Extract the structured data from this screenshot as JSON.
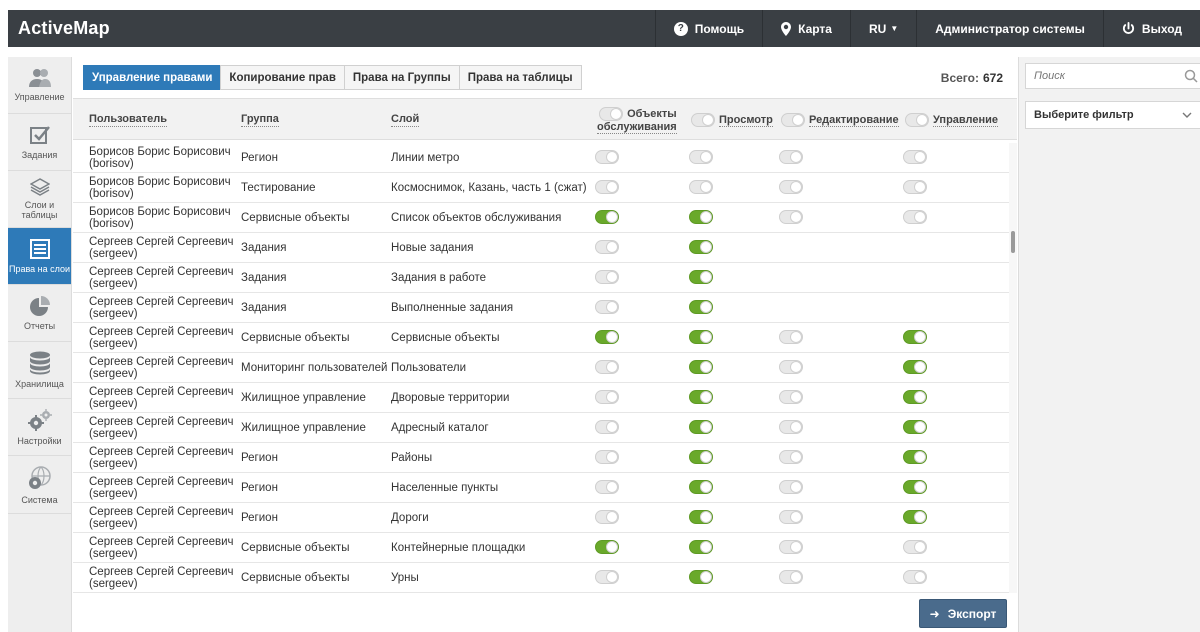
{
  "app": {
    "title": "ActiveMap"
  },
  "topbar": {
    "help": "Помощь",
    "map": "Карта",
    "lang": "RU",
    "user": "Администратор системы",
    "logout": "Выход"
  },
  "sidebar": {
    "items": [
      {
        "label": "Управление",
        "icon": "users-icon",
        "active": false
      },
      {
        "label": "Задания",
        "icon": "checkbox-icon",
        "active": false
      },
      {
        "label": "Слои и таблицы",
        "icon": "layers-icon",
        "active": false
      },
      {
        "label": "Права на слои",
        "icon": "list-icon",
        "active": true
      },
      {
        "label": "Отчеты",
        "icon": "pie-chart-icon",
        "active": false
      },
      {
        "label": "Хранилища",
        "icon": "database-icon",
        "active": false
      },
      {
        "label": "Настройки",
        "icon": "gears-icon",
        "active": false
      },
      {
        "label": "Система",
        "icon": "globe-gear-icon",
        "active": false
      }
    ]
  },
  "tabs": [
    {
      "label": "Управление правами",
      "active": true
    },
    {
      "label": "Копирование прав",
      "active": false
    },
    {
      "label": "Права на Группы",
      "active": false
    },
    {
      "label": "Права на таблицы",
      "active": false
    }
  ],
  "total": {
    "label": "Всего:",
    "value": "672"
  },
  "table": {
    "columns": {
      "user": "Пользователь",
      "group": "Группа",
      "layer": "Слой",
      "service_1": "Объекты",
      "service_2": "обслуживания",
      "view": "Просмотр",
      "edit": "Редактирование",
      "manage": "Управление"
    },
    "rows": [
      {
        "user1": "Борисов Борис Борисович",
        "user2": "(borisov)",
        "group": "Регион",
        "layer": "Линии метро",
        "t": [
          0,
          0,
          0,
          0
        ]
      },
      {
        "user1": "Борисов Борис Борисович",
        "user2": "(borisov)",
        "group": "Тестирование",
        "layer": "Космоснимок, Казань, часть 1 (сжат)",
        "t": [
          0,
          0,
          0,
          0
        ]
      },
      {
        "user1": "Борисов Борис Борисович",
        "user2": "(borisov)",
        "group": "Сервисные объекты",
        "layer": "Список объектов обслуживания",
        "t": [
          1,
          1,
          0,
          0
        ]
      },
      {
        "user1": "Сергеев Сергей Сергеевич",
        "user2": "(sergeev)",
        "group": "Задания",
        "layer": "Новые задания",
        "t": [
          0,
          1,
          -1,
          -1
        ]
      },
      {
        "user1": "Сергеев Сергей Сергеевич",
        "user2": "(sergeev)",
        "group": "Задания",
        "layer": "Задания в работе",
        "t": [
          0,
          1,
          -1,
          -1
        ]
      },
      {
        "user1": "Сергеев Сергей Сергеевич",
        "user2": "(sergeev)",
        "group": "Задания",
        "layer": "Выполненные задания",
        "t": [
          0,
          1,
          -1,
          -1
        ]
      },
      {
        "user1": "Сергеев Сергей Сергеевич",
        "user2": "(sergeev)",
        "group": "Сервисные объекты",
        "layer": "Сервисные объекты",
        "t": [
          1,
          1,
          0,
          1
        ]
      },
      {
        "user1": "Сергеев Сергей Сергеевич",
        "user2": "(sergeev)",
        "group": "Мониторинг пользователей",
        "layer": "Пользователи",
        "t": [
          0,
          1,
          0,
          1
        ]
      },
      {
        "user1": "Сергеев Сергей Сергеевич",
        "user2": "(sergeev)",
        "group": "Жилищное управление",
        "layer": "Дворовые территории",
        "t": [
          0,
          1,
          0,
          1
        ]
      },
      {
        "user1": "Сергеев Сергей Сергеевич",
        "user2": "(sergeev)",
        "group": "Жилищное управление",
        "layer": "Адресный каталог",
        "t": [
          0,
          1,
          0,
          1
        ]
      },
      {
        "user1": "Сергеев Сергей Сергеевич",
        "user2": "(sergeev)",
        "group": "Регион",
        "layer": "Районы",
        "t": [
          0,
          1,
          0,
          1
        ]
      },
      {
        "user1": "Сергеев Сергей Сергеевич",
        "user2": "(sergeev)",
        "group": "Регион",
        "layer": "Населенные пункты",
        "t": [
          0,
          1,
          0,
          1
        ]
      },
      {
        "user1": "Сергеев Сергей Сергеевич",
        "user2": "(sergeev)",
        "group": "Регион",
        "layer": "Дороги",
        "t": [
          0,
          1,
          0,
          1
        ]
      },
      {
        "user1": "Сергеев Сергей Сергеевич",
        "user2": "(sergeev)",
        "group": "Сервисные объекты",
        "layer": "Контейнерные площадки",
        "t": [
          1,
          1,
          0,
          0
        ]
      },
      {
        "user1": "Сергеев Сергей Сергеевич",
        "user2": "(sergeev)",
        "group": "Сервисные объекты",
        "layer": "Урны",
        "t": [
          0,
          1,
          0,
          0
        ]
      }
    ]
  },
  "export": {
    "label": "Экспорт"
  },
  "search": {
    "placeholder": "Поиск"
  },
  "filter": {
    "label": "Выберите фильтр"
  },
  "colors": {
    "topbar": "#3a3f44",
    "accent": "#2e7ab8",
    "toggle_on": "#6aa92b",
    "export": "#4a6b8c"
  }
}
